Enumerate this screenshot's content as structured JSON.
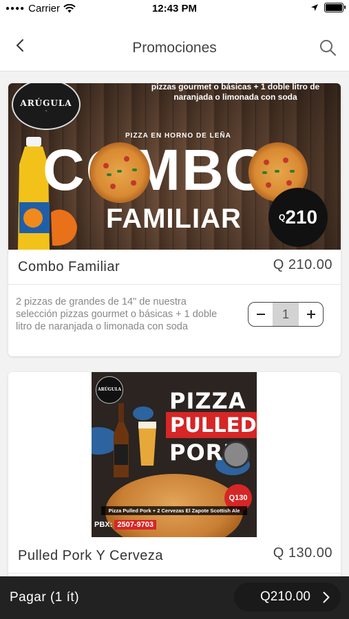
{
  "status_bar": {
    "carrier": "Carrier",
    "time": "12:43 PM"
  },
  "nav": {
    "title": "Promociones"
  },
  "items": [
    {
      "name": "Combo Familiar",
      "price": "Q 210.00",
      "description": "2 pizzas de grandes de 14\" de nuestra selección pizzas gourmet o básicas + 1 doble litro de naranjada o limonada con soda",
      "quantity": "1",
      "image": {
        "logo": "ARÚGULA",
        "top_text": "pizzas gourmet o básicas + 1 doble litro de naranjada o limonada con soda",
        "subtitle": "PIZZA EN HORNO DE LEÑA",
        "headline1": "COMBO",
        "headline2": "FAMILIAR",
        "badge_currency": "Q",
        "badge_amount": "210"
      }
    },
    {
      "name": "Pulled Pork Y Cerveza",
      "price": "Q 130.00",
      "image": {
        "logo": "ARÚGULA",
        "line1": "PIZZA",
        "line2": "PULLED",
        "line3": "PORK",
        "badge": "Q130",
        "caption": "Pizza Pulled Pork + 2 Cervezas El Zapote Scottish Ale",
        "pbx_label": "PBX:",
        "pbx_number": "2507-9703"
      }
    }
  ],
  "bottom_bar": {
    "pay_label": "Pagar (1 ít)",
    "total": "Q210.00"
  },
  "colors": {
    "bottom_bar": "#222222",
    "badge_red": "#d62626"
  },
  "icons": {
    "back": "chevron-left-icon",
    "search": "search-icon",
    "forward": "chevron-right-icon"
  }
}
